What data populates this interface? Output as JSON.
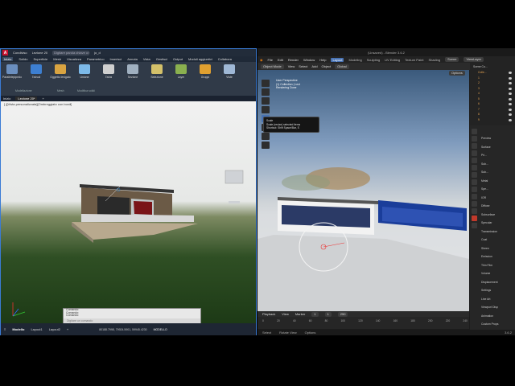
{
  "autocad": {
    "app_tab": "Condiviso",
    "doc_tab": "Lezione 20",
    "search_placeholder": "Digitare parola chiave o frase",
    "user": "jo_d",
    "menu": [
      "Inizio",
      "Solido",
      "Superficie",
      "Mesh",
      "Visualizza",
      "Parametrico",
      "Inserisci",
      "Annota",
      "Vista",
      "Gestisci",
      "Output",
      "Moduli aggiuntivi",
      "Collabora"
    ],
    "ribbon": [
      {
        "label": "Parallelepipedo",
        "color": "#6b8fbf"
      },
      {
        "label": "Estrudi",
        "color": "#3d7fd1"
      },
      {
        "label": "Oggetto levigato",
        "color": "#d9a441"
      },
      {
        "label": "Unione",
        "color": "#7cb9e8"
      },
      {
        "label": "Estrai",
        "color": "#cfcfcf"
      },
      {
        "label": "Sezione",
        "color": "#a0b0c0"
      },
      {
        "label": "Selezione",
        "color": "#d4c16a"
      },
      {
        "label": "Layer",
        "color": "#8ab04f"
      },
      {
        "label": "Gruppi",
        "color": "#e0a030"
      },
      {
        "label": "Viste",
        "color": "#9fb8d6"
      }
    ],
    "ribbon_groups": [
      "Modellazione",
      "Mesh",
      "Modifica solidi"
    ],
    "file_tabs": [
      "Inizio",
      "Lezione 20*"
    ],
    "viewport_label": "[-][Vista personalizzata][Ombreggiato con bordi]",
    "cmd_lines": [
      "Comando:",
      "Comando:",
      "Comando:"
    ],
    "cmd_placeholder": "Digitare un comando",
    "layout_tabs": [
      "Modello",
      "Layout1",
      "Layout2"
    ],
    "coords": "80188.7998, 79924.5901, 59945.4230",
    "mode": "MODELLO"
  },
  "blender": {
    "title": "(Unsaved) - Blender 3.6.2",
    "menu": [
      "File",
      "Edit",
      "Render",
      "Window",
      "Help"
    ],
    "workspaces": [
      "Layout",
      "Modeling",
      "Sculpting",
      "UV Editing",
      "Texture Paint",
      "Shading"
    ],
    "scene": "Scene",
    "view_layer": "ViewLayer",
    "header": [
      "Object Mode",
      "View",
      "Select",
      "Add",
      "Object"
    ],
    "orientation": "Global",
    "viewport_info": [
      "User Perspective",
      "(1) Collection | Lezi",
      "Rendering Done"
    ],
    "tooltip": [
      "Scale",
      "Scale (resize) selected items",
      "Shortcut: Shift Space/Bar, S"
    ],
    "options": "Options",
    "timeline_menu": [
      "Playback",
      "View",
      "Marker"
    ],
    "frame_current": "1",
    "start": "1",
    "end": "250",
    "timeline_nums": [
      "0",
      "20",
      "40",
      "60",
      "80",
      "100",
      "120",
      "140",
      "160",
      "180",
      "200",
      "220",
      "240"
    ],
    "status": [
      "Select",
      "Rotate View",
      "Options"
    ],
    "version": "3.6.2",
    "outliner_header": "Scene Co...",
    "outliner_items": [
      "Colle...",
      "1",
      "2",
      "3",
      "4",
      "5",
      "6",
      "7",
      "8",
      "9"
    ],
    "props": [
      "Preview",
      "Surface",
      "Pri...",
      "Sub...",
      "Sub...",
      "Metal",
      "Spe...",
      "IOR",
      "Diffuse",
      "Subsurface",
      "Specular",
      "Transmission",
      "Coat",
      "Sheen",
      "Emission",
      "Thin Film",
      "Volume",
      "Displacement",
      "Settings",
      "Line Art",
      "Viewport Disp",
      "Animation",
      "Custom Props"
    ]
  }
}
